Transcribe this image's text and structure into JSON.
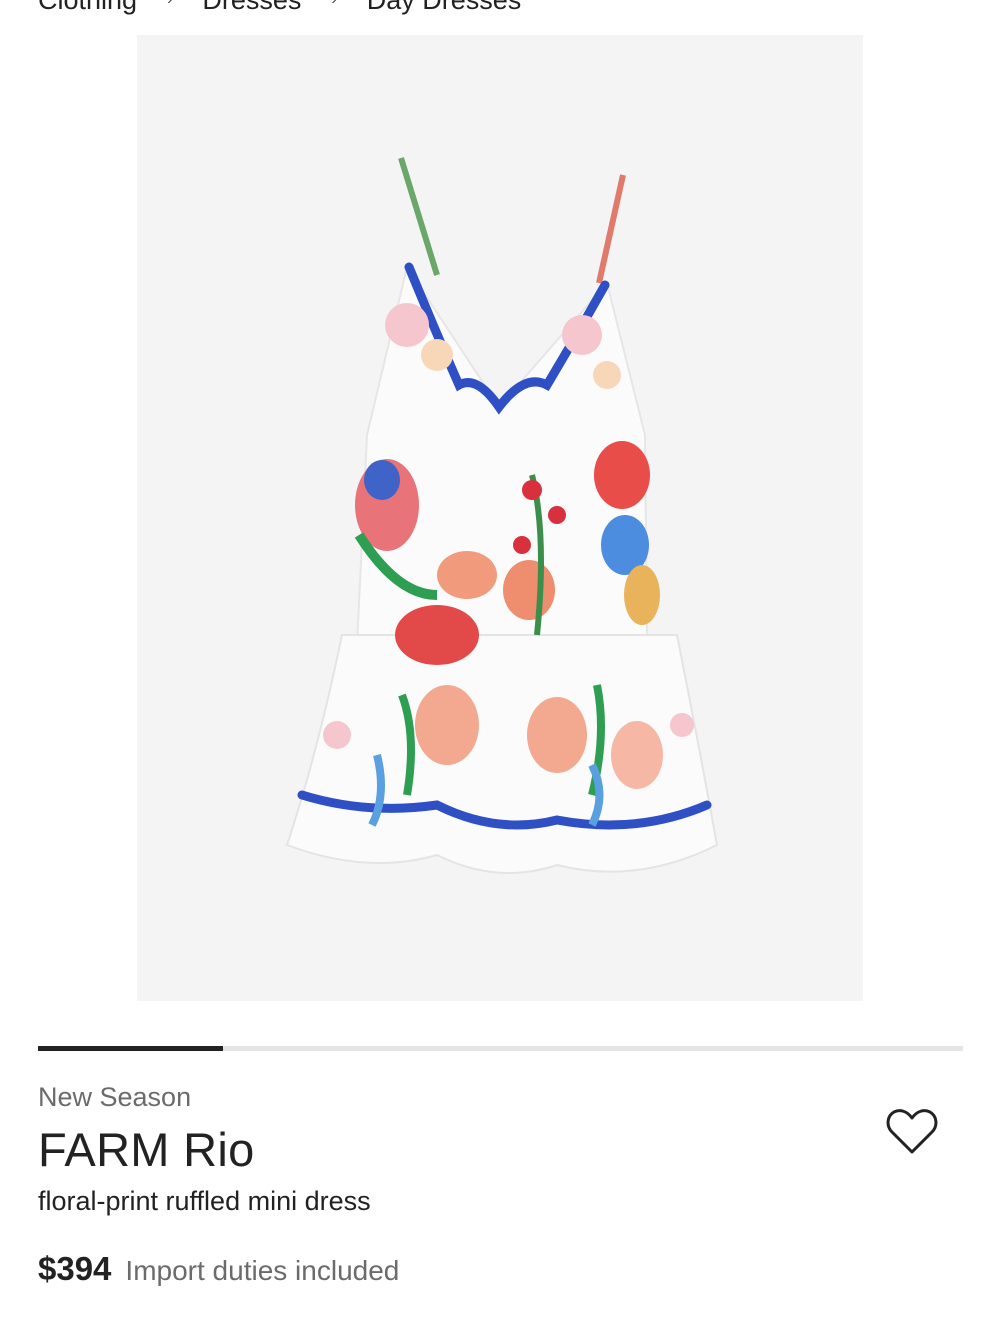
{
  "breadcrumb": {
    "items": [
      "Clothing",
      "Dresses",
      "Day Dresses"
    ],
    "separator": "›"
  },
  "product_image": {
    "description_icon": "dress-image",
    "background": "#f4f4f4"
  },
  "carousel": {
    "progress": 0.2,
    "fill_color": "#222222",
    "track_color": "#e5e5e5"
  },
  "product": {
    "season": "New Season",
    "brand": "FARM Rio",
    "name": "floral-print ruffled mini dress",
    "price": "$394",
    "duties_note": "Import duties included"
  },
  "wishlist": {
    "icon": "heart-outline-icon"
  }
}
